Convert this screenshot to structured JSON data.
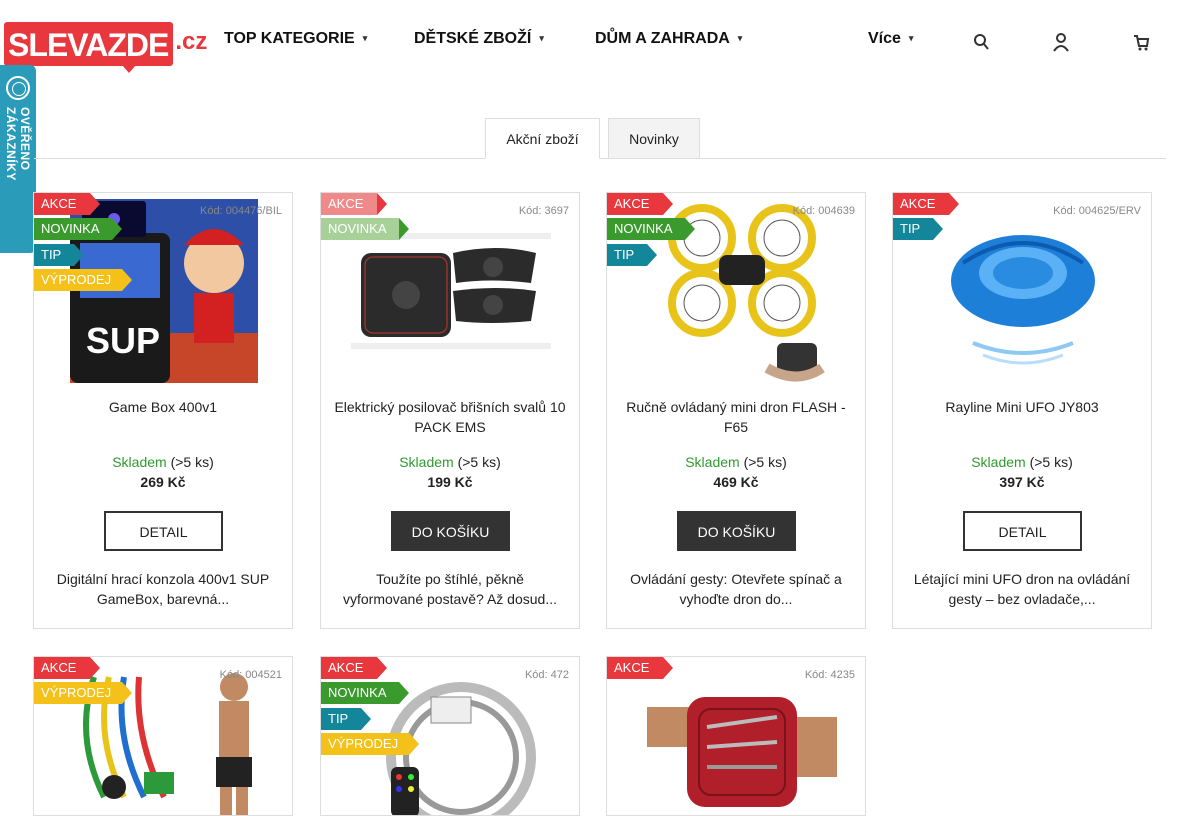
{
  "header": {
    "logo_main": "SLEVAZDE",
    "logo_tld": ".cz",
    "nav": [
      {
        "label": "TOP KATEGORIE"
      },
      {
        "label": "DĚTSKÉ ZBOŽÍ"
      },
      {
        "label": "DŮM A ZAHRADA"
      },
      {
        "label": "Více"
      }
    ],
    "icons": [
      "search-icon",
      "user-icon",
      "cart-icon"
    ]
  },
  "side_badge": {
    "text": "OVĚŘENO ZÁKAZNÍKY"
  },
  "tabs": [
    {
      "label": "Akční zboží",
      "active": true
    },
    {
      "label": "Novinky",
      "active": false
    }
  ],
  "products": [
    {
      "code": "Kód: 004476/BIL",
      "flags": [
        "AKCE",
        "NOVINKA",
        "TIP",
        "VÝPRODEJ"
      ],
      "name": "Game Box 400v1",
      "stock_status": "Skladem",
      "stock_qty": "(>5 ks)",
      "price": "269 Kč",
      "button": "DETAIL",
      "description": "Digitální hrací konzola 400v1 SUP GameBox, barevná..."
    },
    {
      "code": "Kód: 3697",
      "flags": [
        "AKCE",
        "NOVINKA"
      ],
      "name": "Elektrický posilovač břišních svalů 10 PACK EMS",
      "stock_status": "Skladem",
      "stock_qty": "(>5 ks)",
      "price": "199 Kč",
      "button": "DO KOŠÍKU",
      "description": "Toužíte po štíhlé, pěkně vyformované postavě? Až dosud..."
    },
    {
      "code": "Kód: 004639",
      "flags": [
        "AKCE",
        "NOVINKA",
        "TIP"
      ],
      "name": "Ručně ovládaný mini dron FLASH - F65",
      "stock_status": "Skladem",
      "stock_qty": "(>5 ks)",
      "price": "469 Kč",
      "button": "DO KOŠÍKU",
      "description": "Ovládání gesty: Otevřete spínač a vyhoďte dron do..."
    },
    {
      "code": "Kód: 004625/ERV",
      "flags": [
        "AKCE",
        "TIP"
      ],
      "name": "Rayline Mini UFO JY803",
      "stock_status": "Skladem",
      "stock_qty": "(>5 ks)",
      "price": "397 Kč",
      "button": "DETAIL",
      "description": "Létající mini UFO dron na ovládání gesty – bez ovladače,..."
    },
    {
      "code": "Kód: 004521",
      "flags": [
        "AKCE",
        "VÝPRODEJ"
      ]
    },
    {
      "code": "Kód: 472",
      "flags": [
        "AKCE",
        "NOVINKA",
        "TIP",
        "VÝPRODEJ"
      ]
    },
    {
      "code": "Kód: 4235",
      "flags": [
        "AKCE"
      ]
    }
  ]
}
